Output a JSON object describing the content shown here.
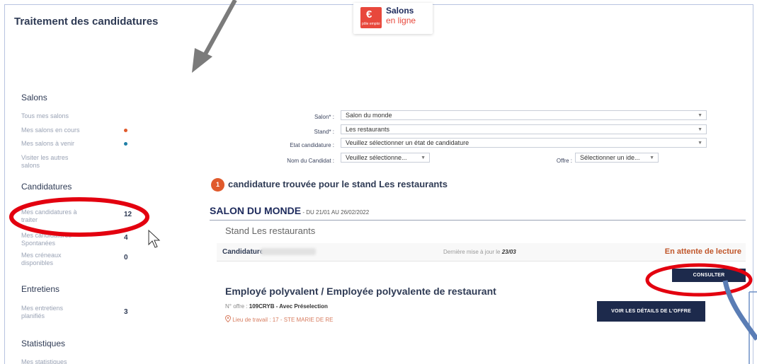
{
  "header": {
    "title": "Traitement des candidatures",
    "brand": {
      "mark": "€",
      "mark_sub": "pôle emploi",
      "line1": "Salons",
      "line2": "en ligne"
    }
  },
  "sidebar": {
    "sections": [
      {
        "title": "Salons",
        "items": [
          {
            "label": "Tous mes salons"
          },
          {
            "label": "Mes salons en cours",
            "dot": "#e05a2c"
          },
          {
            "label": "Mes salons à venir",
            "dot": "#1f7fa6"
          },
          {
            "label": "Visiter les autres salons"
          }
        ]
      },
      {
        "title": "Candidatures",
        "items": [
          {
            "label": "Mes candidatures à traiter",
            "count": "12"
          },
          {
            "label": "Mes candidatures Spontanées",
            "count": "4"
          },
          {
            "label": "Mes créneaux disponibles",
            "count": "0"
          }
        ]
      },
      {
        "title": "Entretiens",
        "items": [
          {
            "label": "Mes entretiens planifiés",
            "count": "3"
          }
        ]
      },
      {
        "title": "Statistiques",
        "items": [
          {
            "label": "Mes statistiques"
          }
        ]
      }
    ]
  },
  "filters": {
    "salon_label": "Salon* :",
    "salon_value": "Salon du monde",
    "stand_label": "Stand* :",
    "stand_value": "Les restaurants",
    "etat_label": "Etat candidature :",
    "etat_value": "Veuillez sélectionner un état de candidature",
    "nom_label": "Nom du Candidat :",
    "nom_value": "Veuillez sélectionne...",
    "offre_label": "Offre :",
    "offre_value": "Sélectionner un ide..."
  },
  "results": {
    "count": "1",
    "text": "candidature trouvée pour le stand Les restaurants"
  },
  "salon": {
    "name": "SALON DU MONDE",
    "dates": " - DU 21/01 AU 26/02/2022",
    "stand": "Stand Les restaurants"
  },
  "candidature": {
    "label": "Candidature",
    "last_update_label": "Dernière mise à jour le",
    "last_update_value": "23/03",
    "status": "En attente de lecture",
    "consult_button": "CONSULTER",
    "job_title": "Employé polyvalent / Employée polyvalente de restaurant",
    "offer_label": "N° offre :",
    "offer_value": "109CRYB - Avec Préselection",
    "workplace": "Lieu de travail : 17 - STE MARIE DE RE",
    "details_button": "VOIR LES DÉTAILS DE L'OFFRE"
  },
  "colors": {
    "accent": "#e05a2c",
    "annotation_red": "#e3000f",
    "annotation_arrow": "#7b7b7b",
    "navy": "#1d2a4c"
  }
}
